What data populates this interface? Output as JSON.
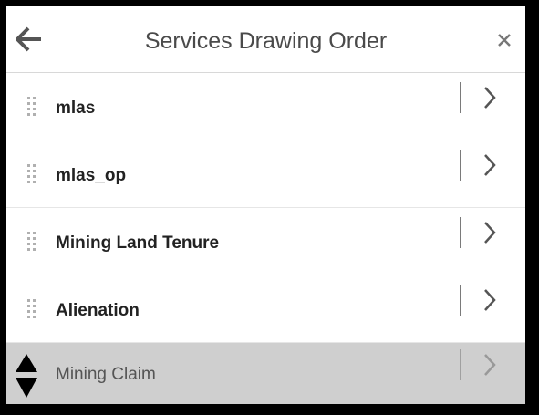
{
  "header": {
    "title": "Services Drawing Order",
    "back_icon": "arrow-left-icon",
    "close_icon": "close-icon"
  },
  "services": [
    {
      "label": "mlas"
    },
    {
      "label": "mlas_op"
    },
    {
      "label": "Mining Land Tenure"
    },
    {
      "label": "Alienation"
    },
    {
      "label": "Mining Claim",
      "state": "dragging"
    }
  ],
  "colors": {
    "background": "#000000",
    "panel": "#ffffff",
    "title_text": "#4a4a4a",
    "item_text": "#222222",
    "dragging_row": "#cfcfcf"
  }
}
